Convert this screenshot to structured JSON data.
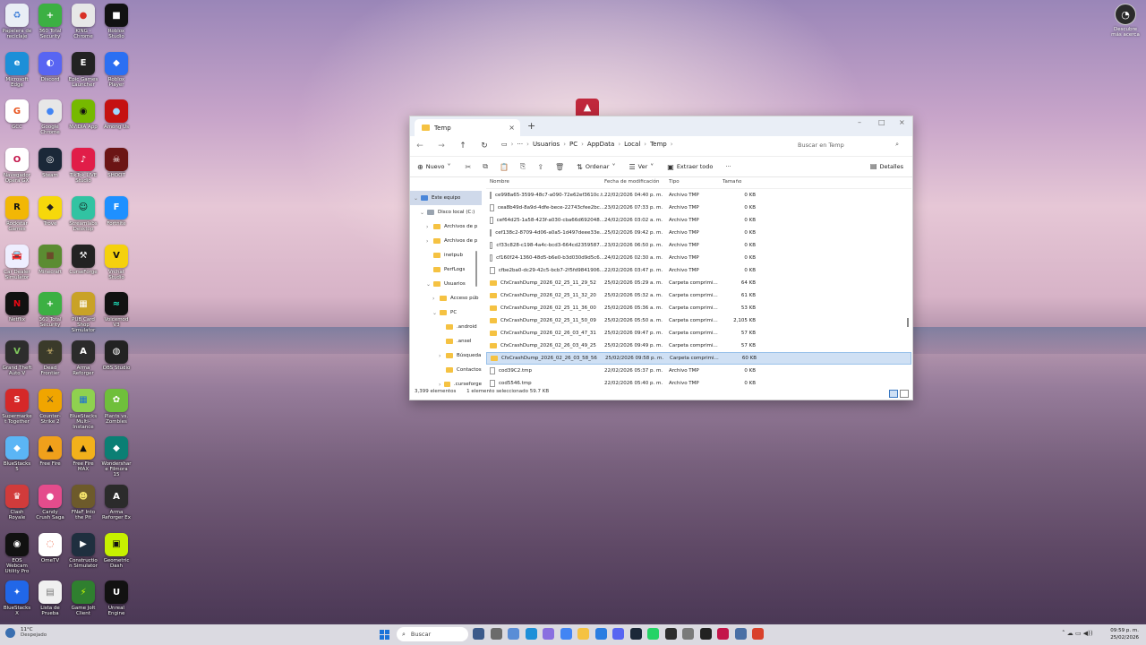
{
  "desktop": {
    "icons": [
      {
        "label": "Papelera de reciclaje",
        "color": "#e9eef5",
        "glyph": "♻",
        "fg": "#3b7dd8"
      },
      {
        "label": "360 Total Security",
        "color": "#3cb043",
        "glyph": "+",
        "fg": "#fff"
      },
      {
        "label": "KING - Chrome",
        "color": "#e7e7e7",
        "glyph": "●",
        "fg": "#d93025"
      },
      {
        "label": "Roblox Studio",
        "color": "#111",
        "glyph": "■",
        "fg": "#fff"
      },
      {
        "label": "Microsoft Edge",
        "color": "#1d8fd8",
        "glyph": "e",
        "fg": "#fff"
      },
      {
        "label": "Discord",
        "color": "#5865f2",
        "glyph": "◐",
        "fg": "#fff"
      },
      {
        "label": "Epic Games Launcher",
        "color": "#222",
        "glyph": "E",
        "fg": "#fff"
      },
      {
        "label": "Roblox Player",
        "color": "#2b6ff2",
        "glyph": "◆",
        "fg": "#fff"
      },
      {
        "label": "GCC",
        "color": "#fff",
        "glyph": "G",
        "fg": "#e8511a"
      },
      {
        "label": "Google Chrome",
        "color": "#e7e7e7",
        "glyph": "●",
        "fg": "#4285f4"
      },
      {
        "label": "NVIDIA App",
        "color": "#76b900",
        "glyph": "◉",
        "fg": "#111"
      },
      {
        "label": "Among Us",
        "color": "#c51111",
        "glyph": "●",
        "fg": "#9fd7ff"
      },
      {
        "label": "Navegador Opera GX",
        "color": "#fff",
        "glyph": "O",
        "fg": "#c3154a"
      },
      {
        "label": "Steam",
        "color": "#1b2838",
        "glyph": "◎",
        "fg": "#fff"
      },
      {
        "label": "TikTok LIVE Studio",
        "color": "#e11d48",
        "glyph": "♪",
        "fg": "#fff"
      },
      {
        "label": "SHOOT",
        "color": "#6b1515",
        "glyph": "☠",
        "fg": "#fff"
      },
      {
        "label": "Rockstar Games",
        "color": "#f2b705",
        "glyph": "R",
        "fg": "#111"
      },
      {
        "label": "Trove",
        "color": "#f6d80b",
        "glyph": "◆",
        "fg": "#222"
      },
      {
        "label": "Streamlabs Desktop",
        "color": "#31c3a2",
        "glyph": "☺",
        "fg": "#111"
      },
      {
        "label": "Fortnite",
        "color": "#1e90ff",
        "glyph": "F",
        "fg": "#fff"
      },
      {
        "label": "Car Dealer Simulator",
        "color": "#eef",
        "glyph": "🚘",
        "fg": "#444"
      },
      {
        "label": "Minecraft",
        "color": "#5b8c32",
        "glyph": "■",
        "fg": "#6b4b2a"
      },
      {
        "label": "CurseForge",
        "color": "#222",
        "glyph": "⚒",
        "fg": "#fff"
      },
      {
        "label": "Vrchat Studio",
        "color": "#f5d10d",
        "glyph": "V",
        "fg": "#111"
      },
      {
        "label": "Netflix",
        "color": "#111",
        "glyph": "N",
        "fg": "#e50914"
      },
      {
        "label": "360 Total Security",
        "color": "#3cb043",
        "glyph": "+",
        "fg": "#fff"
      },
      {
        "label": "PUB Card Shop Simulator",
        "color": "#c9a227",
        "glyph": "▦",
        "fg": "#fff"
      },
      {
        "label": "Voicemod V3",
        "color": "#111",
        "glyph": "≈",
        "fg": "#1ee6c0"
      },
      {
        "label": "Grand Theft Auto V",
        "color": "#2d2d2d",
        "glyph": "V",
        "fg": "#7fc75d"
      },
      {
        "label": "Dead Frontier",
        "color": "#3a3a2a",
        "glyph": "☣",
        "fg": "#d2b870"
      },
      {
        "label": "Arma Reforger",
        "color": "#2b2b2b",
        "glyph": "A",
        "fg": "#fff"
      },
      {
        "label": "OBS Studio",
        "color": "#222",
        "glyph": "◍",
        "fg": "#fff"
      },
      {
        "label": "Supermarket Together",
        "color": "#d62828",
        "glyph": "S",
        "fg": "#fff"
      },
      {
        "label": "Counter-Strike 2",
        "color": "#f0a500",
        "glyph": "⚔",
        "fg": "#1c2a4a"
      },
      {
        "label": "BlueStacks Multi-Instance",
        "color": "#8fd14f",
        "glyph": "▦",
        "fg": "#1a6ed8"
      },
      {
        "label": "Plants vs. Zombies",
        "color": "#6fbf3b",
        "glyph": "✿",
        "fg": "#fff"
      },
      {
        "label": "BlueStacks 5",
        "color": "#5bb5f5",
        "glyph": "◆",
        "fg": "#fff"
      },
      {
        "label": "Free Fire",
        "color": "#f0a01b",
        "glyph": "▲",
        "fg": "#111"
      },
      {
        "label": "Free Fire MAX",
        "color": "#f2b11b",
        "glyph": "▲",
        "fg": "#111"
      },
      {
        "label": "Wondershare Filmora 15",
        "color": "#0b7f74",
        "glyph": "◆",
        "fg": "#fff"
      },
      {
        "label": "Clash Royale",
        "color": "#d13b3b",
        "glyph": "♛",
        "fg": "#fff"
      },
      {
        "label": "Candy Crush Saga",
        "color": "#e44c8c",
        "glyph": "●",
        "fg": "#fff"
      },
      {
        "label": "FNaF Into the Pit",
        "color": "#6d5a2b",
        "glyph": "☻",
        "fg": "#f4e26a"
      },
      {
        "label": "Arma Reforger Ex",
        "color": "#2b2b2b",
        "glyph": "A",
        "fg": "#fff"
      },
      {
        "label": "EOS Webcam Utility Pro",
        "color": "#111",
        "glyph": "◉",
        "fg": "#fff"
      },
      {
        "label": "OmeTV",
        "color": "#fff",
        "glyph": "◌",
        "fg": "#e64"
      },
      {
        "label": "Construction Simulator",
        "color": "#1f2f3f",
        "glyph": "▶",
        "fg": "#fff"
      },
      {
        "label": "Geometric Dash",
        "color": "#c7f000",
        "glyph": "▣",
        "fg": "#111"
      },
      {
        "label": "BlueStacks X",
        "color": "#2167e8",
        "glyph": "✦",
        "fg": "#fff"
      },
      {
        "label": "Lista de Prueba",
        "color": "#f0f0f0",
        "glyph": "▤",
        "fg": "#777"
      },
      {
        "label": "Game Jolt Client",
        "color": "#2f7f2f",
        "glyph": "⚡",
        "fg": "#ccff00"
      },
      {
        "label": "Unreal Engine",
        "color": "#111",
        "glyph": "U",
        "fg": "#fff"
      }
    ],
    "right_icon": {
      "label": "Descubre más acerca",
      "glyph": "◔"
    }
  },
  "explorer": {
    "tab_title": "Temp",
    "tab_close": "×",
    "new_tab": "+",
    "window_controls": [
      "–",
      "□",
      "×"
    ],
    "breadcrumbs": [
      "Usuarios",
      "PC",
      "AppData",
      "Local",
      "Temp"
    ],
    "search_placeholder": "Buscar en Temp",
    "commands": {
      "new": "Nuevo",
      "sort": "Ordenar",
      "view": "Ver",
      "extract": "Extraer todo",
      "more": "···",
      "details": "Detalles"
    },
    "nav_tree": [
      {
        "label": "Este equipo",
        "indent": 0,
        "chev": "⌄",
        "selected": true,
        "icon": "pc"
      },
      {
        "label": "Disco local (C:)",
        "indent": 1,
        "chev": "⌄",
        "icon": "drive"
      },
      {
        "label": "Archivos de p",
        "indent": 2,
        "chev": "›",
        "icon": "folder"
      },
      {
        "label": "Archivos de p",
        "indent": 2,
        "chev": "›",
        "icon": "folder"
      },
      {
        "label": "inetpub",
        "indent": 2,
        "chev": "",
        "icon": "folder"
      },
      {
        "label": "PerfLogs",
        "indent": 2,
        "chev": "",
        "icon": "folder"
      },
      {
        "label": "Usuarios",
        "indent": 2,
        "chev": "⌄",
        "icon": "folder"
      },
      {
        "label": "Acceso púb",
        "indent": 3,
        "chev": "›",
        "icon": "folder"
      },
      {
        "label": "PC",
        "indent": 3,
        "chev": "⌄",
        "icon": "folder"
      },
      {
        "label": ".android",
        "indent": 4,
        "chev": "",
        "icon": "folder"
      },
      {
        "label": ".ansel",
        "indent": 4,
        "chev": "",
        "icon": "folder"
      },
      {
        "label": "Búsqueda",
        "indent": 4,
        "chev": "›",
        "icon": "folder"
      },
      {
        "label": "Contactos",
        "indent": 4,
        "chev": "",
        "icon": "folder"
      },
      {
        "label": ".curseforge",
        "indent": 4,
        "chev": "›",
        "icon": "folder"
      }
    ],
    "columns": [
      "Nombre",
      "Fecha de modificación",
      "Tipo",
      "Tamaño"
    ],
    "rows": [
      {
        "name": "ce998a65-3599-48c7-a090-72e62ef3610c.t...",
        "date": "22/02/2026 04:40 p. m.",
        "type": "Archivo TMP",
        "size": "0 KB",
        "kind": "file"
      },
      {
        "name": "cea8b49d-8a9d-4dfe-bece-22743cfee2bc...",
        "date": "23/02/2026 07:33 p. m.",
        "type": "Archivo TMP",
        "size": "0 KB",
        "kind": "file"
      },
      {
        "name": "cef64d25-1a58-423f-a030-cba66d692048...",
        "date": "24/02/2026 03:02 a. m.",
        "type": "Archivo TMP",
        "size": "0 KB",
        "kind": "file"
      },
      {
        "name": "cef138c2-8709-4d06-a0a5-1d497deee33e...",
        "date": "25/02/2026 09:42 p. m.",
        "type": "Archivo TMP",
        "size": "0 KB",
        "kind": "file"
      },
      {
        "name": "cf33c828-c198-4a4c-bcd3-664cd2359587...",
        "date": "23/02/2026 06:50 p. m.",
        "type": "Archivo TMP",
        "size": "0 KB",
        "kind": "file"
      },
      {
        "name": "cf160f24-1360-48d5-b6e0-b3d030d9d5c6...",
        "date": "24/02/2026 02:30 a. m.",
        "type": "Archivo TMP",
        "size": "0 KB",
        "kind": "file"
      },
      {
        "name": "cfbe2ba0-dc29-42c5-bcb7-2f5fd9841906...",
        "date": "22/02/2026 03:47 p. m.",
        "type": "Archivo TMP",
        "size": "0 KB",
        "kind": "file"
      },
      {
        "name": "CfxCrashDump_2026_02_25_11_29_52",
        "date": "25/02/2026 05:29 a. m.",
        "type": "Carpeta comprimi...",
        "size": "64 KB",
        "kind": "zip"
      },
      {
        "name": "CfxCrashDump_2026_02_25_11_32_20",
        "date": "25/02/2026 05:32 a. m.",
        "type": "Carpeta comprimi...",
        "size": "61 KB",
        "kind": "zip"
      },
      {
        "name": "CfxCrashDump_2026_02_25_11_36_00",
        "date": "25/02/2026 05:36 a. m.",
        "type": "Carpeta comprimi...",
        "size": "53 KB",
        "kind": "zip"
      },
      {
        "name": "CfxCrashDump_2026_02_25_11_50_09",
        "date": "25/02/2026 05:50 a. m.",
        "type": "Carpeta comprimi...",
        "size": "2,105 KB",
        "kind": "zip"
      },
      {
        "name": "CfxCrashDump_2026_02_26_03_47_31",
        "date": "25/02/2026 09:47 p. m.",
        "type": "Carpeta comprimi...",
        "size": "57 KB",
        "kind": "zip"
      },
      {
        "name": "CfxCrashDump_2026_02_26_03_49_25",
        "date": "25/02/2026 09:49 p. m.",
        "type": "Carpeta comprimi...",
        "size": "57 KB",
        "kind": "zip"
      },
      {
        "name": "CfxCrashDump_2026_02_26_03_58_56",
        "date": "25/02/2026 09:58 p. m.",
        "type": "Carpeta comprimi...",
        "size": "60 KB",
        "kind": "zip",
        "selected": true
      },
      {
        "name": "cod39C2.tmp",
        "date": "22/02/2026 05:37 p. m.",
        "type": "Archivo TMP",
        "size": "0 KB",
        "kind": "file"
      },
      {
        "name": "cod5546.tmp",
        "date": "22/02/2026 05:40 p. m.",
        "type": "Archivo TMP",
        "size": "0 KB",
        "kind": "file"
      }
    ],
    "status_count": "3,399 elementos",
    "status_selected": "1 elemento seleccionado  59.7 KB"
  },
  "taskbar": {
    "weather_temp": "11°C",
    "weather_desc": "Despejado",
    "search_label": "Buscar",
    "time": "09:59 p. m.",
    "date": "25/02/2026",
    "apps": [
      {
        "name": "gamepass",
        "color": "#3c5a8a"
      },
      {
        "name": "taskview",
        "color": "#6b6b6b"
      },
      {
        "name": "widgets",
        "color": "#5a8dd6"
      },
      {
        "name": "edge",
        "color": "#1d8fd8"
      },
      {
        "name": "copilot",
        "color": "#8a6fe0"
      },
      {
        "name": "chrome",
        "color": "#4285f4"
      },
      {
        "name": "explorer",
        "color": "#f5c242"
      },
      {
        "name": "store",
        "color": "#2a7de1"
      },
      {
        "name": "discord",
        "color": "#5865f2"
      },
      {
        "name": "steam",
        "color": "#1b2838"
      },
      {
        "name": "whatsapp",
        "color": "#25d366"
      },
      {
        "name": "spotify-like",
        "color": "#2d2d2d"
      },
      {
        "name": "settings",
        "color": "#7a7a7a"
      },
      {
        "name": "roblox",
        "color": "#222"
      },
      {
        "name": "opera",
        "color": "#c3154a"
      },
      {
        "name": "monitor",
        "color": "#4a6fa5"
      },
      {
        "name": "close-app",
        "color": "#d9412b"
      }
    ]
  }
}
